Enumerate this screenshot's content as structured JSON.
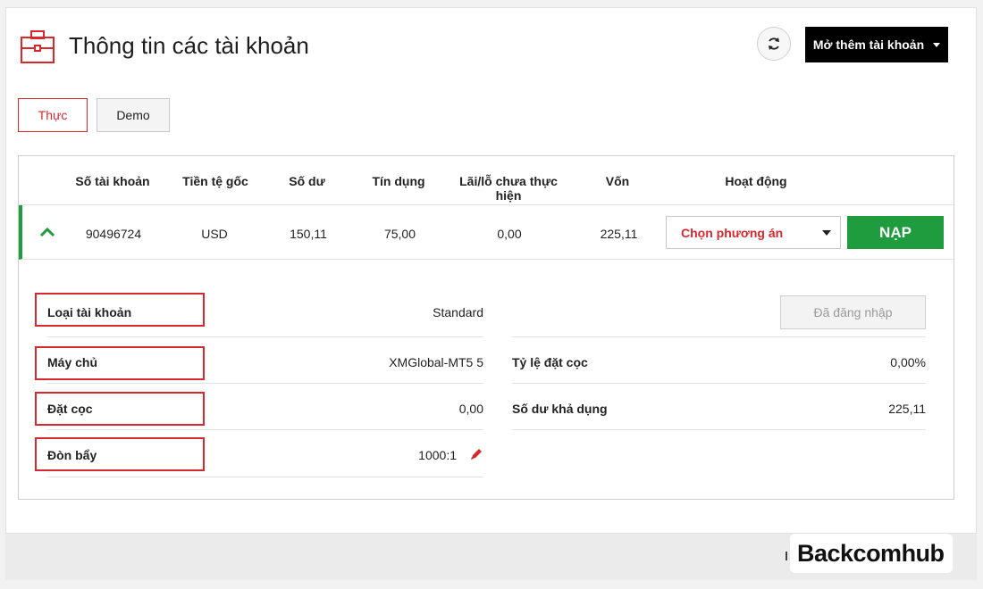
{
  "header": {
    "title": "Thông tin các tài khoản",
    "open_account_label": "Mở thêm tài khoản",
    "icons": {
      "title": "briefcase-icon",
      "refresh": "refresh-icon",
      "dropdown": "caret-down-icon"
    }
  },
  "tabs": [
    {
      "label": "Thực",
      "active": true
    },
    {
      "label": "Demo",
      "active": false
    }
  ],
  "table": {
    "headers": [
      "Số tài khoản",
      "Tiền tệ gốc",
      "Số dư",
      "Tín dụng",
      "Lãi/lỗ chưa thực hiện",
      "Vốn",
      "Hoạt động"
    ],
    "row": {
      "account_number": "90496724",
      "currency": "USD",
      "balance": "150,11",
      "credit": "75,00",
      "unrealized_pl": "0,00",
      "equity": "225,11",
      "action_select": "Chọn phương án",
      "deposit_label": "NẠP"
    }
  },
  "details": {
    "left": [
      {
        "label": "Loại tài khoản",
        "value": "Standard"
      },
      {
        "label": "Máy chủ",
        "value": "XMGlobal-MT5 5"
      },
      {
        "label": "Đặt cọc",
        "value": "0,00"
      },
      {
        "label": "Đòn bẩy",
        "value": "1000:1"
      }
    ],
    "right": [
      {
        "label": "Tỷ lệ đặt cọc",
        "value": "0,00%"
      },
      {
        "label": "Số dư khả dụng",
        "value": "225,11"
      }
    ],
    "logged_in_label": "Đã đăng nhập"
  },
  "brand": {
    "text": "Backcomhub"
  },
  "colors": {
    "accent_red": "#d9272e",
    "accent_green": "#1e9c3e",
    "black": "#000000"
  }
}
